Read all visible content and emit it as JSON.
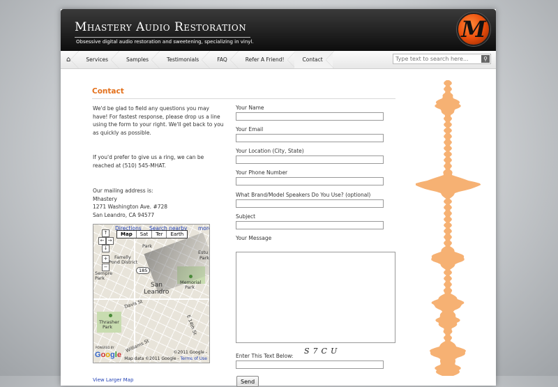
{
  "header": {
    "title": "Mhastery Audio Restoration",
    "tagline": "Obsessive digital audio restoration and sweetening, specializing in vinyl.",
    "logo_letter": "M"
  },
  "nav": {
    "home_icon": "home-icon",
    "items": [
      "Services",
      "Samples",
      "Testimonials",
      "FAQ",
      "Refer A Friend!",
      "Contact"
    ],
    "current": "Contact",
    "search_placeholder": "Type text to search here...",
    "search_button_icon": "search-go-icon"
  },
  "page": {
    "title": "Contact",
    "intro": "We'd be glad to field any questions you may have! For fastest response, please drop us a line using the form to your right. We'll get back to you as quickly as possible.",
    "phone_text": "If you'd prefer to give us a ring, we can be reached at (510) 545-MHAT.",
    "mailing_intro": "Our mailing address is:",
    "address": [
      "Mhastery",
      "1271 Washington Ave. #728",
      "San Leandro, CA 94577"
    ]
  },
  "map": {
    "links": [
      "Directions",
      "Search nearby",
      "more"
    ],
    "types": [
      "Map",
      "Sat",
      "Ter",
      "Earth"
    ],
    "selected_type": "Map",
    "labels": {
      "park": "Park",
      "estudillo": "Estu",
      "estudillo2": "Park",
      "farrelly": "Farrelly",
      "pond_district": "Pond District",
      "highway": "185",
      "sempre": "Sempre",
      "park2": "Park",
      "san_leandro_1": "San",
      "san_leandro_2": "Leandro",
      "memorial": "Memorial",
      "memorial_park": "Park",
      "davis": "Davis St",
      "e14th": "E 14th St",
      "thrasher": "Thrasher",
      "thrasher_park": "Park",
      "williams": "Williams St"
    },
    "powered_by": "POWERED BY",
    "copyright": "©2011 Google -",
    "map_data": "Map data ©2011 Google -",
    "terms": "Terms of Use",
    "larger_map": "View Larger Map"
  },
  "form": {
    "name_label": "Your Name",
    "email_label": "Your Email",
    "location_label": "Your Location (City, State)",
    "phone_label": "Your Phone Number",
    "speakers_label": "What Brand/Model Speakers Do You Use? (optional)",
    "subject_label": "Subject",
    "message_label": "Your Message",
    "captcha_label": "Enter This Text Below:",
    "captcha_text": "S7CU",
    "send_label": "Send"
  },
  "colors": {
    "accent": "#e3701b",
    "waveform": "#f5a35a",
    "header_bg": "#141414",
    "link": "#2241b5"
  }
}
